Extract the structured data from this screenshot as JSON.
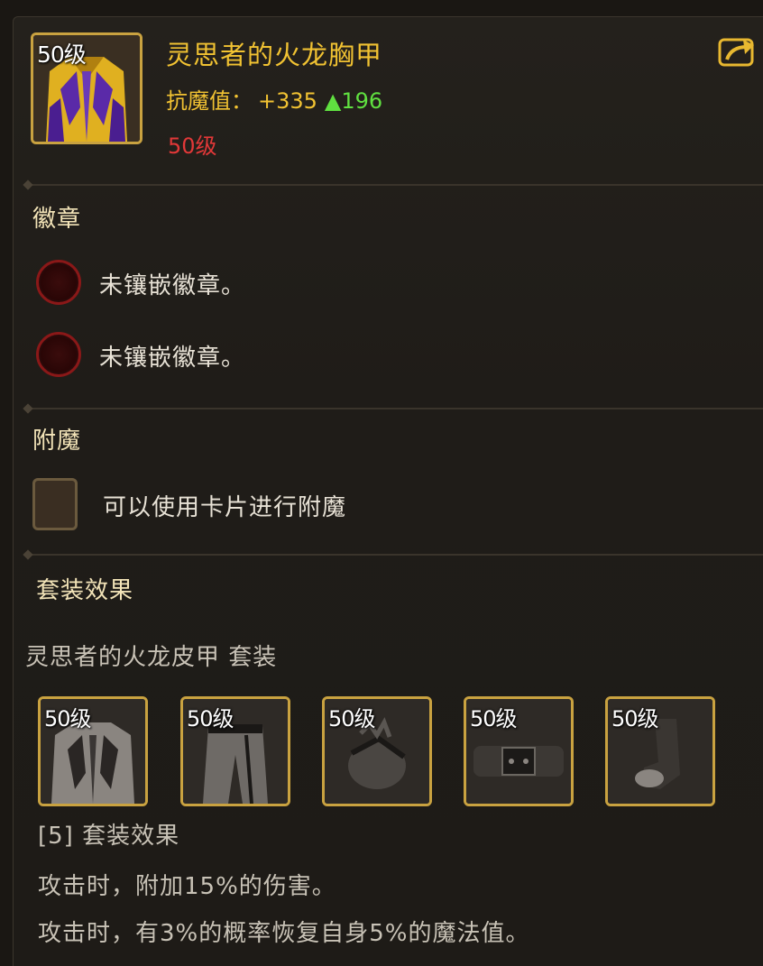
{
  "item": {
    "level_badge": "50级",
    "name": "灵思者的火龙胸甲",
    "stat_label": "抗魔值：",
    "stat_value": "+335",
    "stat_increase": "▲196",
    "required_level": "50级"
  },
  "badges": {
    "title": "徽章",
    "slots": [
      {
        "text": "未镶嵌徽章。"
      },
      {
        "text": "未镶嵌徽章。"
      }
    ]
  },
  "enchant": {
    "title": "附魔",
    "hint": "可以使用卡片进行附魔"
  },
  "set": {
    "title": "套装效果",
    "set_name": "灵思者的火龙皮甲   套装",
    "pieces": [
      {
        "level": "50级",
        "icon": "chest-armor-icon"
      },
      {
        "level": "50级",
        "icon": "pants-icon"
      },
      {
        "level": "50级",
        "icon": "gloves-icon"
      },
      {
        "level": "50级",
        "icon": "belt-icon"
      },
      {
        "level": "50级",
        "icon": "boots-icon"
      }
    ],
    "bonus_header": "[5] 套装效果",
    "bonus_lines": [
      "攻击时，附加15%的伤害。",
      "攻击时，有3%的概率恢复自身5%的魔法值。"
    ]
  },
  "colors": {
    "item_name": "#f1c232",
    "stat_increase": "#60e040",
    "required_level": "#e23838",
    "slot_border": "#c9a240"
  }
}
